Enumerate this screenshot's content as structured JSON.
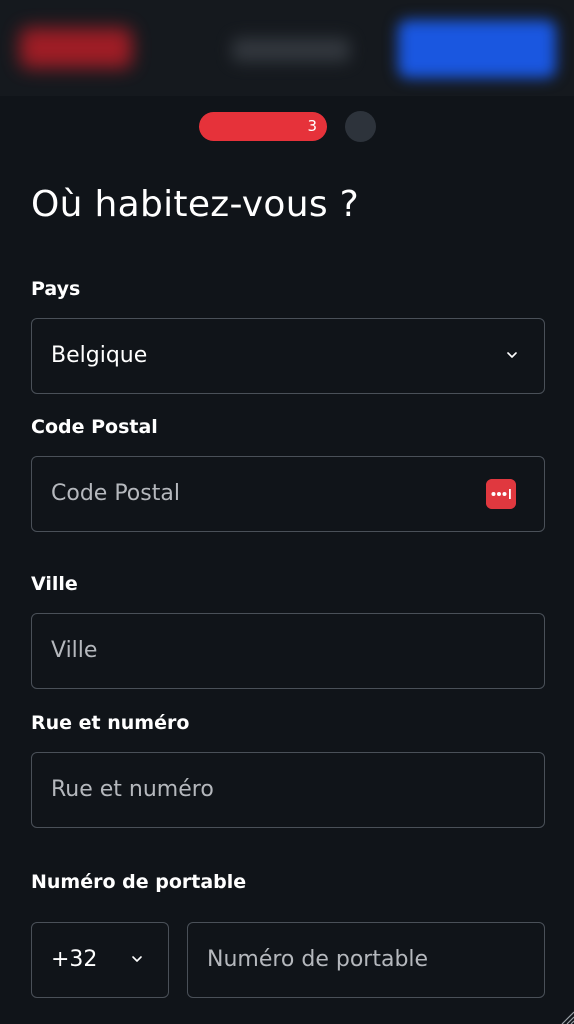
{
  "stepper": {
    "current_step": "3"
  },
  "heading": "Où habitez-vous ?",
  "country": {
    "label": "Pays",
    "value": "Belgique"
  },
  "postal_code": {
    "label": "Code Postal",
    "placeholder": "Code Postal"
  },
  "city": {
    "label": "Ville",
    "placeholder": "Ville"
  },
  "street": {
    "label": "Rue et numéro",
    "placeholder": "Rue et numéro"
  },
  "mobile": {
    "label": "Numéro de portable",
    "country_code": "+32",
    "placeholder": "Numéro de portable"
  },
  "icons": {
    "chevron": "chevron-down-icon",
    "password_manager": "password-manager-icon",
    "resize": "resize-handle-icon"
  },
  "colors": {
    "accent_red": "#e6323a",
    "background": "#101419",
    "border": "#4a5058",
    "header_blue": "#1a57e0"
  }
}
